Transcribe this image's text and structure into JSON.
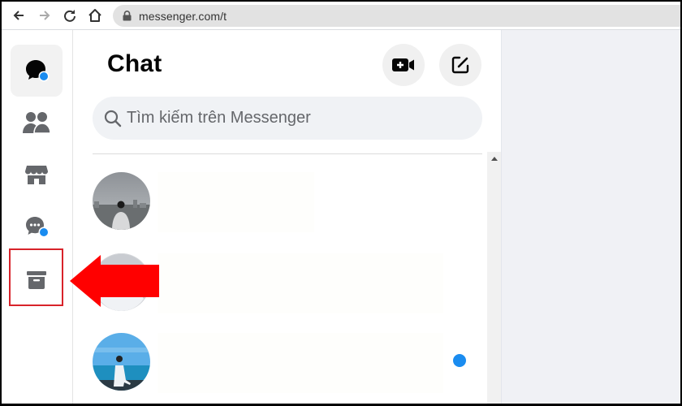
{
  "browser": {
    "url": "messenger.com/t",
    "nav_icons": [
      "back-arrow-icon",
      "forward-arrow-icon",
      "reload-icon",
      "home-icon",
      "lock-icon"
    ]
  },
  "rail": {
    "items": [
      {
        "name": "chats",
        "icon": "chat-bubble-icon",
        "active": true,
        "badge": true
      },
      {
        "name": "people",
        "icon": "people-icon",
        "active": false,
        "badge": false
      },
      {
        "name": "marketplace",
        "icon": "store-icon",
        "active": false,
        "badge": false
      },
      {
        "name": "requests",
        "icon": "message-requests-icon",
        "active": false,
        "badge": true
      },
      {
        "name": "archive",
        "icon": "archive-box-icon",
        "active": false,
        "badge": false,
        "highlighted": true
      }
    ]
  },
  "chat": {
    "title": "Chat",
    "new_room_icon": "video-plus-icon",
    "compose_icon": "compose-icon",
    "search": {
      "placeholder": "Tìm kiếm trên Messenger",
      "value": ""
    },
    "conversations": [
      {
        "avatar": "city-skyline-photo",
        "name": "",
        "unread": false
      },
      {
        "avatar": "default-avatar",
        "name": "",
        "unread": false
      },
      {
        "avatar": "beach-photo",
        "name": "",
        "unread": true
      }
    ]
  },
  "colors": {
    "accent_blue": "#1a8cf0",
    "annotation_red": "#ff0000",
    "highlight_border": "#d8232a"
  }
}
